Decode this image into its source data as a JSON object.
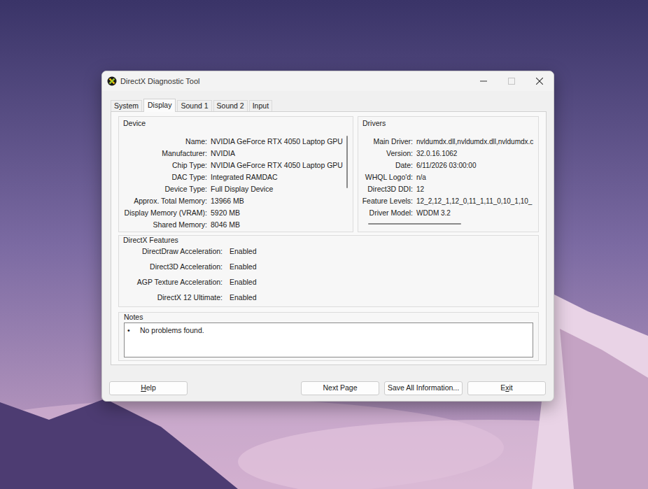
{
  "window": {
    "title": "DirectX Diagnostic Tool",
    "controls": [
      {
        "kind": "minimize",
        "disabled": false
      },
      {
        "kind": "maximize",
        "disabled": true
      },
      {
        "kind": "close",
        "disabled": false
      }
    ]
  },
  "tabs": [
    {
      "label": "System",
      "selected": false
    },
    {
      "label": "Display",
      "selected": true
    },
    {
      "label": "Sound 1",
      "selected": false
    },
    {
      "label": "Sound 2",
      "selected": false
    },
    {
      "label": "Input",
      "selected": false
    }
  ],
  "device": {
    "title": "Device",
    "scroll": {
      "level": 0.55
    },
    "rows": [
      {
        "label": "Name:",
        "value": "NVIDIA GeForce RTX 4050 Laptop GPU"
      },
      {
        "label": "Manufacturer:",
        "value": "NVIDIA"
      },
      {
        "label": "Chip Type:",
        "value": "NVIDIA GeForce RTX 4050 Laptop GPU"
      },
      {
        "label": "DAC Type:",
        "value": "Integrated RAMDAC"
      },
      {
        "label": "Device Type:",
        "value": "Full Display Device"
      },
      {
        "label": "Approx. Total Memory:",
        "value": "13966 MB"
      },
      {
        "label": "Display Memory (VRAM):",
        "value": "5920 MB"
      },
      {
        "label": "Shared Memory:",
        "value": "8046 MB"
      }
    ]
  },
  "drivers": {
    "title": "Drivers",
    "scroll": {
      "level": 0.57
    },
    "rows": [
      {
        "label": "Main Driver:",
        "value": "nvldumdx.dll,nvldumdx.dll,nvldumdx.c"
      },
      {
        "label": "Version:",
        "value": "32.0.16.1062"
      },
      {
        "label": "Date:",
        "value": "6/11/2026 03:00:00"
      },
      {
        "label": "WHQL Logo'd:",
        "value": "n/a"
      },
      {
        "label": "Direct3D DDI:",
        "value": "12"
      },
      {
        "label": "Feature Levels:",
        "value": "12_2,12_1,12_0,11_1,11_0,10_1,10_"
      },
      {
        "label": "Driver Model:",
        "value": "WDDM 3.2"
      }
    ]
  },
  "features": {
    "title": "DirectX Features",
    "rows": [
      {
        "label": "DirectDraw Acceleration:",
        "value": "Enabled"
      },
      {
        "label": "Direct3D Acceleration:",
        "value": "Enabled"
      },
      {
        "label": "AGP Texture Acceleration:",
        "value": "Enabled"
      },
      {
        "label": "DirectX 12 Ultimate:",
        "value": "Enabled"
      }
    ]
  },
  "notes": {
    "title": "Notes",
    "items": [
      {
        "bullet": "•",
        "text": "No problems found."
      }
    ]
  },
  "buttons": [
    {
      "label": "Help",
      "mnemonic": "H"
    },
    {
      "label": "Next Page",
      "mnemonic": ""
    },
    {
      "label": "Save All Information...",
      "mnemonic": ""
    },
    {
      "label": "Exit",
      "mnemonic": "x"
    }
  ]
}
